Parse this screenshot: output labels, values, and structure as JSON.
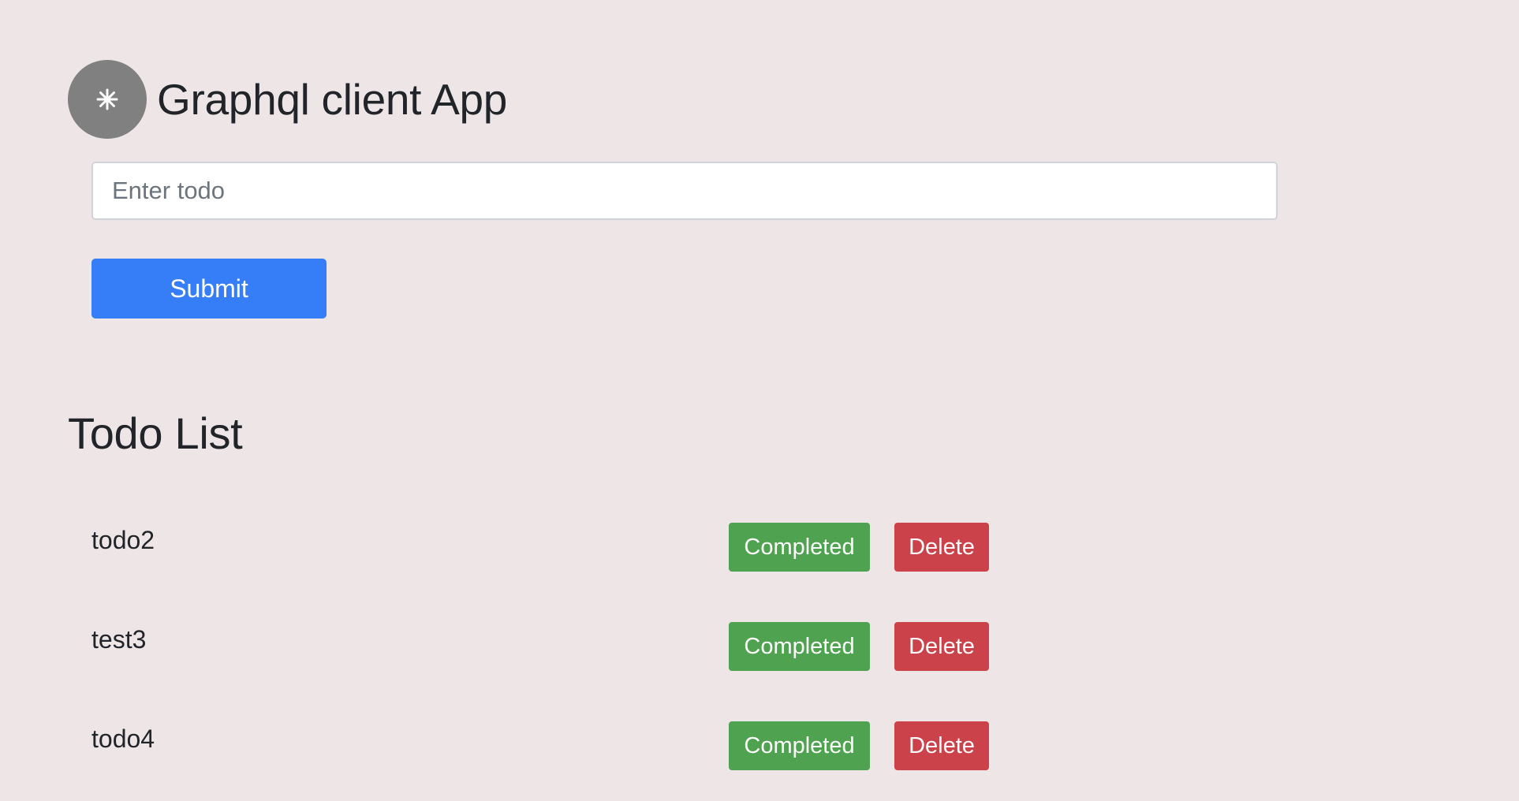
{
  "header": {
    "logo_icon": "asterisk-icon",
    "title": "Graphql client App"
  },
  "form": {
    "input_placeholder": "Enter todo",
    "input_value": "",
    "submit_label": "Submit"
  },
  "list": {
    "title": "Todo List",
    "items": [
      {
        "text": "todo2",
        "complete_label": "Completed",
        "delete_label": "Delete"
      },
      {
        "text": "test3",
        "complete_label": "Completed",
        "delete_label": "Delete"
      },
      {
        "text": "todo4",
        "complete_label": "Completed",
        "delete_label": "Delete"
      }
    ]
  },
  "colors": {
    "background": "#ede5e6",
    "primary": "#357ef8",
    "success": "#4fa24f",
    "danger": "#cc424b",
    "logo": "#808080"
  }
}
